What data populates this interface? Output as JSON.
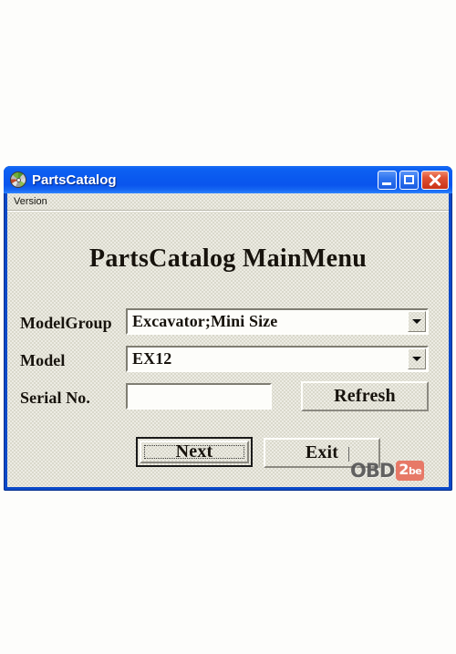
{
  "window": {
    "title": "PartsCatalog",
    "icon": "disc-icon",
    "controls": {
      "minimize": "minimize-button",
      "maximize": "maximize-button",
      "close": "close-button"
    }
  },
  "menu": {
    "items": [
      {
        "label": "Version"
      }
    ]
  },
  "main": {
    "heading": "PartsCatalog MainMenu",
    "fields": [
      {
        "label": "ModelGroup",
        "type": "combobox",
        "value": "Excavator;Mini Size"
      },
      {
        "label": "Model",
        "type": "combobox",
        "value": "EX12"
      },
      {
        "label": "Serial No.",
        "type": "textbox",
        "value": "",
        "placeholder": ""
      }
    ],
    "buttons": {
      "refresh": "Refresh",
      "next": "Next",
      "exit": "Exit"
    }
  },
  "watermark": {
    "part1": "OBD",
    "part2": "2",
    "part3": "be"
  },
  "colors": {
    "titlebar_blue": "#0a59ef",
    "window_border": "#0b49c8",
    "client_face": "#d9d8cb",
    "close_red": "#d83d1c",
    "watermark_red": "#e8705e",
    "page_background": "#fdfdfb"
  }
}
